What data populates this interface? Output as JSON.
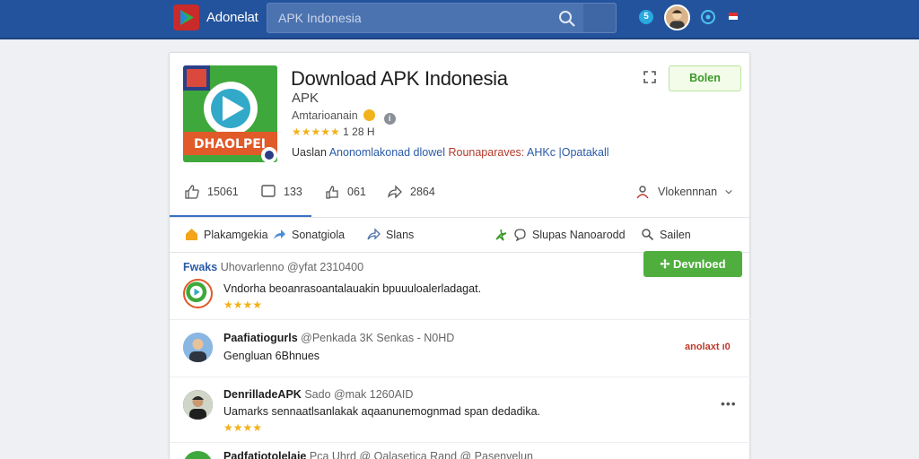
{
  "topbar": {
    "brand": "Adonelat",
    "search_placeholder": "APK Indonesia",
    "notification_badge": "5",
    "colors": {
      "bar": "#23539c",
      "search": "#4b73b0"
    }
  },
  "app": {
    "title": "Download APK Indonesia",
    "subtitle": "APK",
    "developer": "Amtarioanain",
    "rating_stars": "★★★★★",
    "rating_value": "1 28 H",
    "icon_text": "DHAOLPEI",
    "tags_prefix": "Uaslan",
    "tag_blue_1": "Anonomlakonad dlowel",
    "tag_red": "Rounaparaves:",
    "tag_blue_2": "AHKc |Opatakall",
    "follow_label": "Bolen"
  },
  "stats": {
    "likes": "15061",
    "comments": "133",
    "shares": "061",
    "reposts": "2864",
    "more_label": "Vlokennnan"
  },
  "tabs": [
    {
      "label": "Plakamgekia"
    },
    {
      "label": "Sonatgiola"
    },
    {
      "label": "Slans"
    },
    {
      "label": "Slupas Nanoarodd"
    },
    {
      "label": "Sailen"
    }
  ],
  "download_label": "Devnloed",
  "posts": [
    {
      "name": "Fwaks",
      "meta": "Uhovarlenno @yfat 2310400",
      "body": "Vndorha beoanrasoantalauakin bpuuuloalerladagat.",
      "stars": "★★★★"
    },
    {
      "name": "Paafiatiogurls",
      "meta": "@Penkada 3K Senkas - N0HD",
      "body": "Gengluan 6Bhnues",
      "badge": "anolaxt ı0"
    },
    {
      "name": "DenrilladeAPK",
      "meta": "Sado @mak 1260AID",
      "body": "Uamarks sennaatlsanlakak aqaanunemognmad span dedadika.",
      "stars": "★★★★"
    },
    {
      "name": "Padfatiotolelaie",
      "meta": "Pca Uhrd @ Oalasetica Rand @ Pasenvelun"
    }
  ]
}
